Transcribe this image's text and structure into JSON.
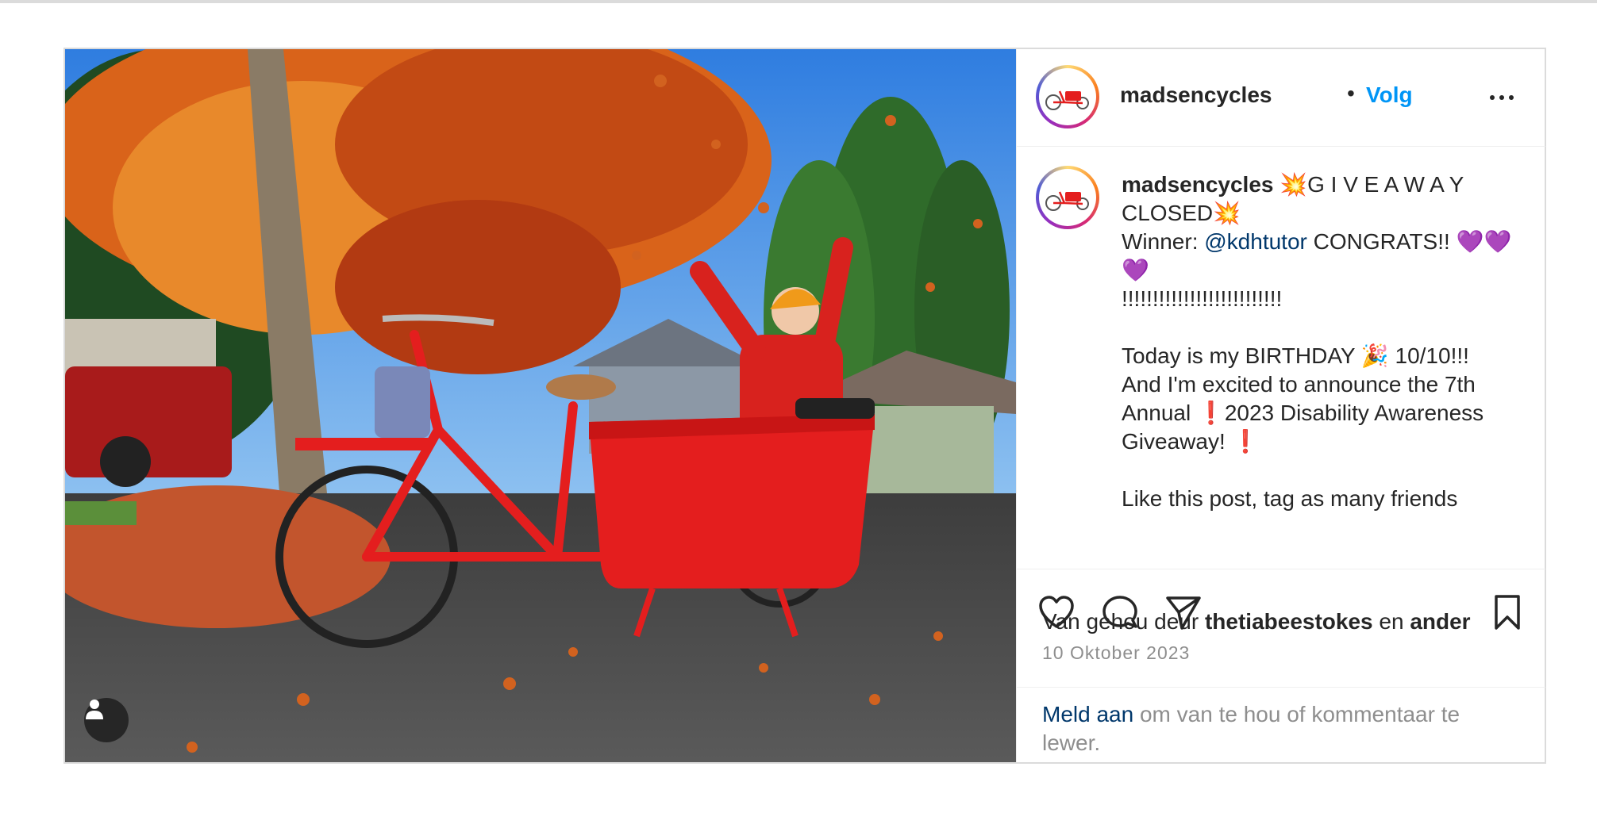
{
  "post": {
    "username": "madsencycles",
    "separator": "•",
    "follow_label": "Volg",
    "more_icon": "more-horizontal-icon",
    "media": {
      "description_icon": "photo",
      "user_tag_icon": "user-tag-icon"
    },
    "caption": {
      "username": "madsencycles",
      "line1": " 💥G I V E A W A Y CLOSED💥\nWinner: ",
      "mention": "@kdhtutor",
      "line2": " CONGRATS!! 💜💜💜\n!!!!!!!!!!!!!!!!!!!!!!!!!!\n\nToday is my BIRTHDAY 🎉 10/10!!!\nAnd I'm excited to announce the 7th Annual ❗2023 Disability Awareness Giveaway! ❗\n\nLike this post, tag as many friends"
    },
    "actions": {
      "like_icon": "heart-icon",
      "comment_icon": "comment-icon",
      "share_icon": "paper-plane-icon",
      "save_icon": "bookmark-icon"
    },
    "likes": {
      "prefix": "Van gehou deur ",
      "user": "thetiabeestokes",
      "middle": " en ",
      "others": "ander"
    },
    "date": "10 Oktober 2023",
    "footer": {
      "login_link": "Meld aan",
      "login_text": " om van te hou of kommentaar te lewer."
    },
    "colors": {
      "accent_blue": "#0095f6",
      "bike_red": "#e41e1e",
      "text": "#262626",
      "muted": "#8e8e8e"
    }
  }
}
